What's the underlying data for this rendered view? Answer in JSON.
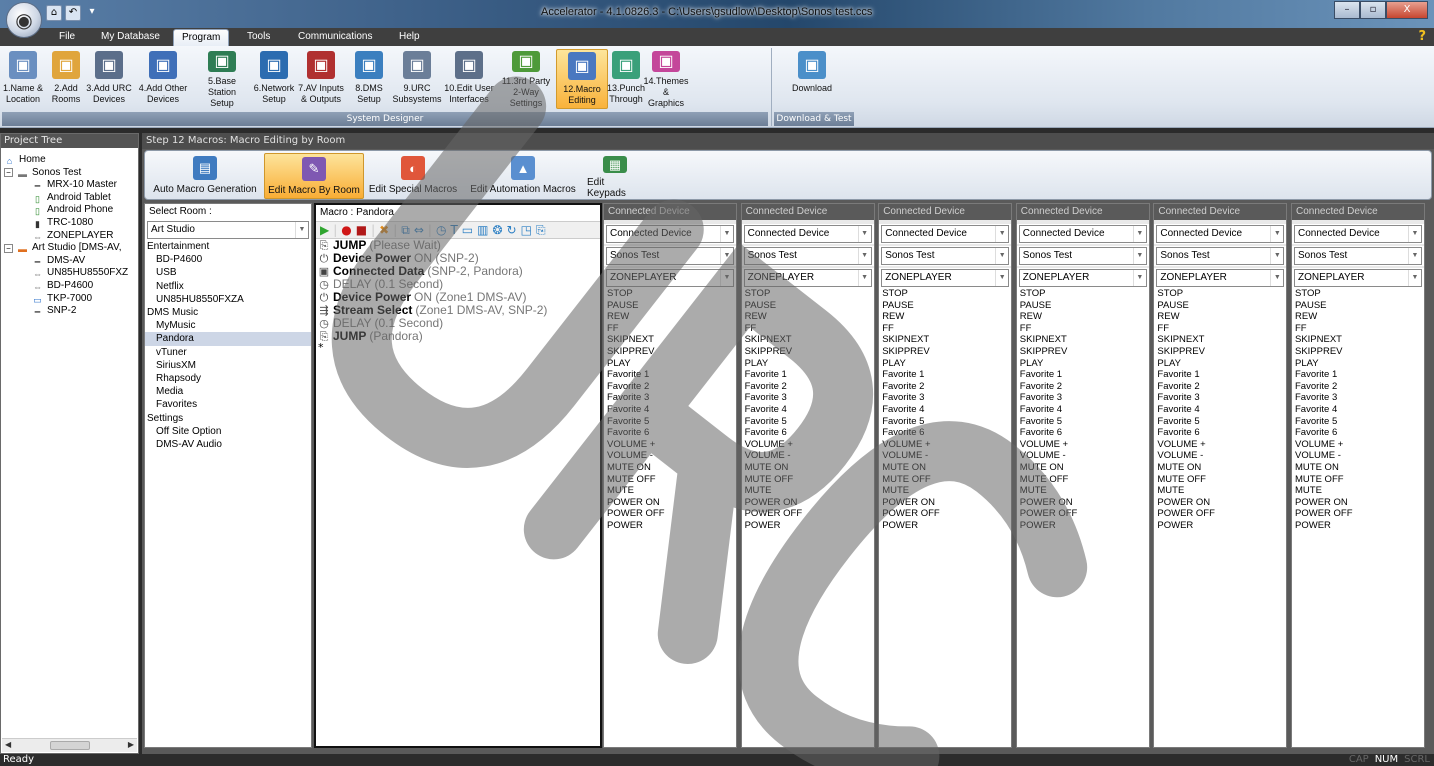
{
  "window": {
    "title": "Accelerator - 4.1.0826.3 - C:\\Users\\gsudlow\\Desktop\\Sonos test.ccs",
    "orb_icon": "app-orb-icon",
    "controls": [
      "–",
      "▫",
      "X"
    ]
  },
  "menu": {
    "items": [
      "File",
      "My Database",
      "Program",
      "Tools",
      "Communications",
      "Help"
    ],
    "active": "Program",
    "help": "?"
  },
  "ribbon": {
    "buttons": [
      {
        "line1": "1.Name &",
        "line2": "Location",
        "icon": "name-location-icon",
        "color": "#6a8fc0"
      },
      {
        "line1": "2.Add",
        "line2": "Rooms",
        "icon": "add-rooms-icon",
        "color": "#e0a53c"
      },
      {
        "line1": "3.Add URC",
        "line2": "Devices",
        "icon": "add-urc-devices-icon",
        "color": "#5b6e8a"
      },
      {
        "line1": "4.Add Other",
        "line2": "Devices",
        "icon": "add-other-devices-icon",
        "color": "#3f6fb8"
      },
      {
        "line1": "5.Base Station",
        "line2": "Setup",
        "icon": "base-station-icon",
        "color": "#2e7d54"
      },
      {
        "line1": "6.Network",
        "line2": "Setup",
        "icon": "network-icon",
        "color": "#2c6cb0"
      },
      {
        "line1": "7.AV Inputs",
        "line2": "& Outputs",
        "icon": "av-io-icon",
        "color": "#b03030"
      },
      {
        "line1": "8.DMS",
        "line2": "Setup",
        "icon": "dms-icon",
        "color": "#3b7fbf"
      },
      {
        "line1": "9.URC",
        "line2": "Subsystems",
        "icon": "subsystems-icon",
        "color": "#6b7e98"
      },
      {
        "line1": "10.Edit User",
        "line2": "Interfaces",
        "icon": "edit-ui-icon",
        "color": "#5d6f89"
      },
      {
        "line1": "11.3rd Party",
        "line2": "2-Way Settings",
        "icon": "two-way-icon",
        "color": "#4e9a3a"
      },
      {
        "line1": "12.Macro",
        "line2": "Editing",
        "icon": "macro-editing-icon",
        "color": "#4a78c0"
      },
      {
        "line1": "13.Punch",
        "line2": "Through",
        "icon": "punch-through-icon",
        "color": "#3aa07a"
      },
      {
        "line1": "14.Themes",
        "line2": "& Graphics",
        "icon": "themes-icon",
        "color": "#c4469a"
      },
      {
        "line1": "Download",
        "line2": "",
        "icon": "download-icon",
        "color": "#4b8fc9"
      }
    ],
    "active_index": 11,
    "group_system": "System Designer",
    "group_download": "Download & Test"
  },
  "project_tree": {
    "header": "Project Tree",
    "items": [
      {
        "label": "Home",
        "level": 0,
        "icon": "home-icon"
      },
      {
        "label": "Sonos Test",
        "level": 1,
        "icon": "room-icon"
      },
      {
        "label": "MRX-10 Master",
        "level": 2,
        "icon": "controller-icon"
      },
      {
        "label": "Android Tablet",
        "level": 2,
        "icon": "tablet-icon"
      },
      {
        "label": "Android Phone",
        "level": 2,
        "icon": "phone-icon"
      },
      {
        "label": "TRC-1080",
        "level": 2,
        "icon": "remote-icon"
      },
      {
        "label": "ZONEPLAYER",
        "level": 2,
        "icon": "ir-device-icon"
      },
      {
        "label": "Art Studio [DMS-AV,",
        "level": 1,
        "icon": "room-icon"
      },
      {
        "label": "DMS-AV",
        "level": 2,
        "icon": "controller-icon"
      },
      {
        "label": "UN85HU8550FXZ",
        "level": 2,
        "icon": "ir-device-icon"
      },
      {
        "label": "BD-P4600",
        "level": 2,
        "icon": "ir-device-icon"
      },
      {
        "label": "TKP-7000",
        "level": 2,
        "icon": "touchpanel-icon"
      },
      {
        "label": "SNP-2",
        "level": 2,
        "icon": "controller-icon"
      }
    ]
  },
  "step": {
    "header": "Step 12 Macros: Macro Editing by Room",
    "tabs": [
      {
        "label": "Auto Macro Generation",
        "icon": "auto-macro-icon",
        "color": "#3f7bc0"
      },
      {
        "label": "Edit Macro By Room",
        "icon": "edit-macro-room-icon",
        "color": "#7f58b2"
      },
      {
        "label": "Edit Special Macros",
        "icon": "special-macros-icon",
        "color": "#e0563a"
      },
      {
        "label": "Edit Automation Macros",
        "icon": "automation-macros-icon",
        "color": "#5a8fd0"
      },
      {
        "label": "Edit Keypads",
        "icon": "keypads-icon",
        "color": "#3a8d4a"
      }
    ],
    "active_tab": 1
  },
  "room_panel": {
    "label": "Select Room :",
    "selected_room": "Art Studio",
    "list": [
      {
        "text": "Entertainment",
        "type": "cat"
      },
      {
        "text": "BD-P4600",
        "type": "sub"
      },
      {
        "text": "USB",
        "type": "sub"
      },
      {
        "text": "Netflix",
        "type": "sub"
      },
      {
        "text": "UN85HU8550FXZA",
        "type": "sub"
      },
      {
        "text": "DMS Music",
        "type": "cat"
      },
      {
        "text": "MyMusic",
        "type": "sub"
      },
      {
        "text": "Pandora",
        "type": "sub",
        "selected": true
      },
      {
        "text": "vTuner",
        "type": "sub"
      },
      {
        "text": "SiriusXM",
        "type": "sub"
      },
      {
        "text": "Rhapsody",
        "type": "sub"
      },
      {
        "text": "Media",
        "type": "sub"
      },
      {
        "text": "Favorites",
        "type": "sub"
      },
      {
        "text": "Settings",
        "type": "cat"
      },
      {
        "text": "Off Site Option",
        "type": "sub"
      },
      {
        "text": "DMS-AV Audio",
        "type": "sub"
      }
    ]
  },
  "macro_panel": {
    "header": "Macro : Pandora",
    "steps": [
      {
        "icon": "jump-icon",
        "cmd": "JUMP",
        "arg": "(Please Wait)",
        "bold": true
      },
      {
        "icon": "power-icon",
        "cmd": "Device Power",
        "arg": "ON (SNP-2)",
        "bold": true
      },
      {
        "icon": "data-icon",
        "cmd": "Connected Data",
        "arg": "(SNP-2, Pandora)",
        "bold": true
      },
      {
        "icon": "clock-icon",
        "cmd": "DELAY",
        "arg": "(0.1 Second)",
        "bold": false
      },
      {
        "icon": "power-icon",
        "cmd": "Device Power",
        "arg": "ON (Zone1 DMS-AV)",
        "bold": true
      },
      {
        "icon": "stream-icon",
        "cmd": "Stream Select",
        "arg": "(Zone1 DMS-AV, SNP-2)",
        "bold": true
      },
      {
        "icon": "clock-icon",
        "cmd": "DELAY",
        "arg": "(0.1 Second)",
        "bold": false
      },
      {
        "icon": "jump-icon",
        "cmd": "JUMP",
        "arg": "(Pandora)",
        "bold": true
      }
    ],
    "new_row_marker": "*",
    "toolbar_icons": [
      "play-icon",
      "record-icon",
      "stop-icon",
      "delete-icon",
      "copy-icon",
      "swap-icon",
      "delay-icon",
      "text-icon",
      "image-icon",
      "variable-icon",
      "condition-icon",
      "loop-icon",
      "jump-toolbar-icon"
    ]
  },
  "device_columns": {
    "header": "Connected Device",
    "device_type": "Connected Device",
    "room": "Sonos Test",
    "device": "ZONEPLAYER",
    "commands": [
      "STOP",
      "PAUSE",
      "REW",
      "FF",
      "SKIPNEXT",
      "SKIPPREV",
      "PLAY",
      "Favorite 1",
      "Favorite 2",
      "Favorite 3",
      "Favorite 4",
      "Favorite 5",
      "Favorite 6",
      "VOLUME +",
      "VOLUME -",
      "MUTE ON",
      "MUTE OFF",
      "MUTE",
      "POWER ON",
      "POWER OFF",
      "POWER"
    ],
    "count": 6
  },
  "status": {
    "text": "Ready",
    "cap": "CAP",
    "num": "NUM",
    "scrl": "SCRL"
  },
  "watermark": "URC"
}
